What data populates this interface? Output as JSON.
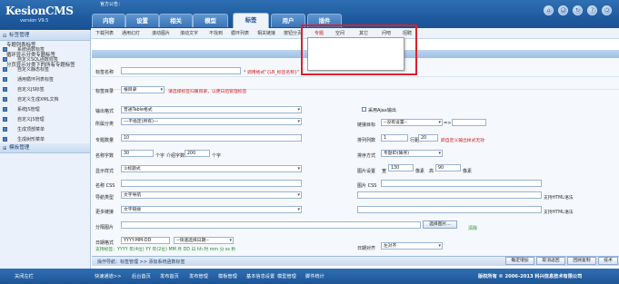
{
  "app": {
    "logo": "KesionCMS",
    "version": "version V9.5",
    "announcement": "官方公告："
  },
  "tabs": [
    {
      "label": "内容"
    },
    {
      "label": "设置"
    },
    {
      "label": "相关"
    },
    {
      "label": "模型"
    },
    {
      "label": "标签"
    },
    {
      "label": "用户"
    },
    {
      "label": "插件"
    }
  ],
  "top_icons": [
    "home-icon",
    "people-icon",
    "refresh-icon",
    "help-icon",
    "logout-icon"
  ],
  "subnav": {
    "items": [
      "下载列表",
      "通用幻灯",
      "滚动图片",
      "滚动文字",
      "不找到",
      "循环列表",
      "相关链接",
      "按钮分页",
      "专题",
      "空间",
      "其它",
      "问吧",
      "招聘"
    ],
    "separator": "|"
  },
  "dropdown": {
    "items": [
      "专题列表标签",
      "循环显示分类专题标签",
      "分页显示分类下的所有专题标签"
    ]
  },
  "sidebar": {
    "section1": "标签管理",
    "items": [
      "系统函数标签",
      "自定义SQL函数标签",
      "自定义静态标签",
      "通用循环列表标签",
      "自定义JS标签",
      "自定义生成XML文档",
      "系统JS管理",
      "自定义JS管理",
      "生成顶部菜单",
      "生成树形菜单"
    ],
    "section2": "模板管理"
  },
  "form": {
    "name_label": "标签名称",
    "name_hint": "* 调用格式\"{LB_标签名称}\"",
    "dir_label": "标签目录",
    "dir_value": "根目录",
    "dir_hint": "请选择标签归属目录，以便日后管理标签",
    "output_label": "输出格式",
    "output_value": "普通Table格式",
    "ajax_label": "采用Ajax输出",
    "channel_label": "所属分类",
    "channel_value": "---不指定(所有)---",
    "link_label": "链接目标",
    "link_value": "--没有设置--",
    "count_label": "专题数量",
    "count_value": "10",
    "cols_label": "排列列数",
    "cols_value": "1",
    "rowspace_label": "行距",
    "rowspace_value": "20",
    "cols_hint": "即自定义输出样式无效",
    "titlelen_label": "名称字数",
    "titlelen_value": "30",
    "unit_char": "个字",
    "introlen_label": "介绍字数",
    "introlen_value": "200",
    "unit_char2": "个字",
    "order_label": "排序方式",
    "order_value": "专题ID(降序)",
    "style_label": "显示样式",
    "style_value": "①标题式",
    "imgsize_label": "图片设置",
    "width_label": "宽",
    "width_value": "130",
    "px": "像素",
    "height_label": "高",
    "height_value": "90",
    "px2": "像素",
    "css_label": "名称 CSS",
    "imgcss_label": "图片 CSS",
    "navtype_label": "导航类型",
    "navtype_value": "文字导航",
    "html_hint": "支持HTML语法",
    "more_label": "更多链接",
    "more_value": "文字链接",
    "html_hint2": "支持HTML语法",
    "splitimg_label": "分隔图片",
    "select_img_btn": "选择图片...",
    "clear_link": "清除",
    "datefmt_label": "日期格式",
    "datefmt_value": "YYYY-MM-DD",
    "datefmt_select": "--快速选择日期--",
    "date_hint": "支持标签：YYYY 年(4位) YY 年(2位) MM 月 DD 日 hh 时 mm 分 ss 秒",
    "align_label": "日期对齐",
    "align_value": "左对齐"
  },
  "opbar": {
    "nav": "操作导航：标签管理 >> 添加系统函数标签",
    "buttons": [
      "确定增加",
      "取消返回",
      "回顾复制",
      "技术"
    ]
  },
  "bottom": {
    "close_left": "关闭左栏",
    "items": [
      "快速通道>>",
      "后台首页",
      "发布首页",
      "发布管理",
      "模板管理",
      "基本信息设置",
      "模型管理",
      "脚件统计"
    ],
    "copyright": "版权所有 © 2006-2013 科兴信息技术有限公司"
  }
}
